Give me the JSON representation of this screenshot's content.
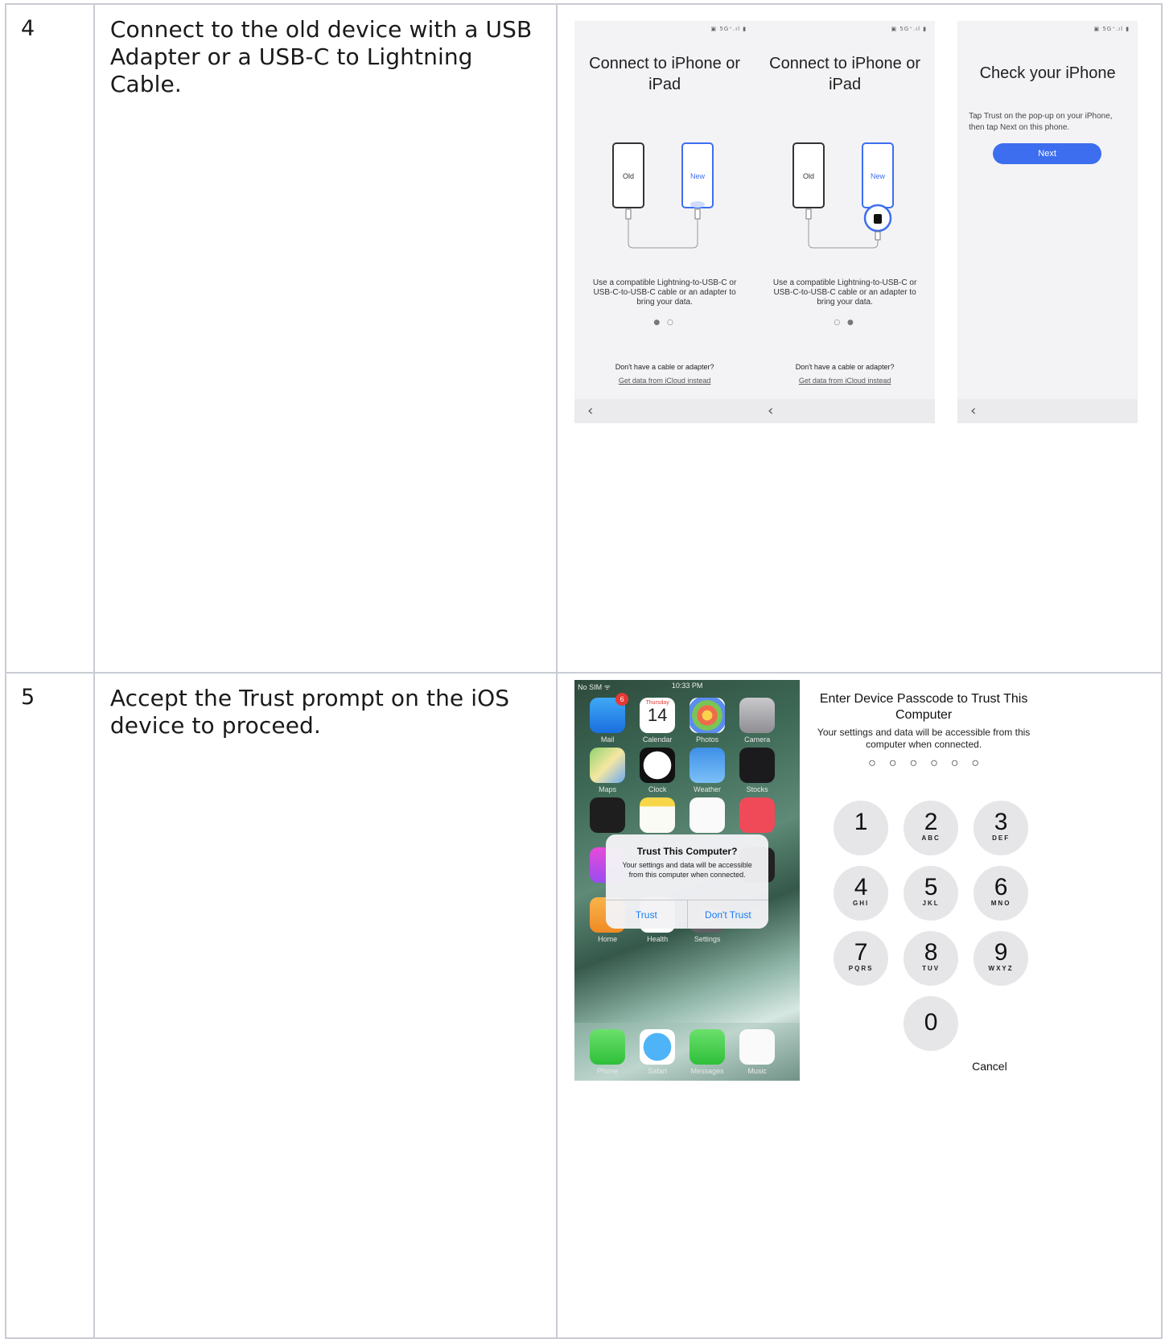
{
  "rows": [
    {
      "number": "4",
      "instruction": "Connect to the old device with a USB Adapter or a USB-C to Lightning Cable.",
      "screens": [
        {
          "status": "▣ 5G⁺.ıl ▮",
          "title": "Connect to iPhone or iPad",
          "old_label": "Old",
          "new_label": "New",
          "description": "Use a compatible Lightning-to-USB-C or USB-C-to-USB-C cable or an adapter to bring your data.",
          "dots": "● ○",
          "no_cable": "Don't have a cable or adapter?",
          "icloud_link": "Get data from iCloud instead",
          "back": "‹"
        },
        {
          "status": "▣ 5G⁺.ıl ▮",
          "title": "Connect to iPhone or iPad",
          "old_label": "Old",
          "new_label": "New",
          "description": "Use a compatible Lightning-to-USB-C or USB-C-to-USB-C cable or an adapter to bring your data.",
          "dots": "○ ●",
          "no_cable": "Don't have a cable or adapter?",
          "icloud_link": "Get data from iCloud instead",
          "back": "‹"
        },
        {
          "status": "▣ 5G⁺.ıl ▮",
          "title": "Check your iPhone",
          "description": "Tap Trust on the pop-up on your iPhone, then tap Next on this phone.",
          "next_label": "Next",
          "back": "‹"
        }
      ]
    },
    {
      "number": "5",
      "instruction": "Accept the Trust prompt on the iOS device to proceed.",
      "ios_home": {
        "carrier": "No SIM ᯤ",
        "time": "10:33 PM",
        "calendar_day": "Thursday",
        "calendar_date": "14",
        "mail_badge": "6",
        "apps": [
          "Mail",
          "Calendar",
          "Photos",
          "Camera",
          "Maps",
          "Clock",
          "Weather",
          "Stocks",
          "Home",
          "Health",
          "Settings"
        ],
        "dock": [
          "Phone",
          "Safari",
          "Messages",
          "Music"
        ],
        "alert_title": "Trust This Computer?",
        "alert_message": "Your settings and data will be accessible from this computer when connected.",
        "trust_label": "Trust",
        "dont_trust_label": "Don't Trust"
      },
      "passcode": {
        "title": "Enter Device Passcode to Trust This Computer",
        "description": "Your settings and data will be accessible from this computer when connected.",
        "dots": "○○○○○○",
        "keys": [
          {
            "n": "1",
            "s": ""
          },
          {
            "n": "2",
            "s": "ABC"
          },
          {
            "n": "3",
            "s": "DEF"
          },
          {
            "n": "4",
            "s": "GHI"
          },
          {
            "n": "5",
            "s": "JKL"
          },
          {
            "n": "6",
            "s": "MNO"
          },
          {
            "n": "7",
            "s": "PQRS"
          },
          {
            "n": "8",
            "s": "TUV"
          },
          {
            "n": "9",
            "s": "WXYZ"
          },
          {
            "n": "0",
            "s": ""
          }
        ],
        "cancel_label": "Cancel"
      }
    }
  ],
  "colors": {
    "accent": "#3d6ef0",
    "ios_link": "#1a7cf5",
    "border": "#c9ccd3"
  }
}
